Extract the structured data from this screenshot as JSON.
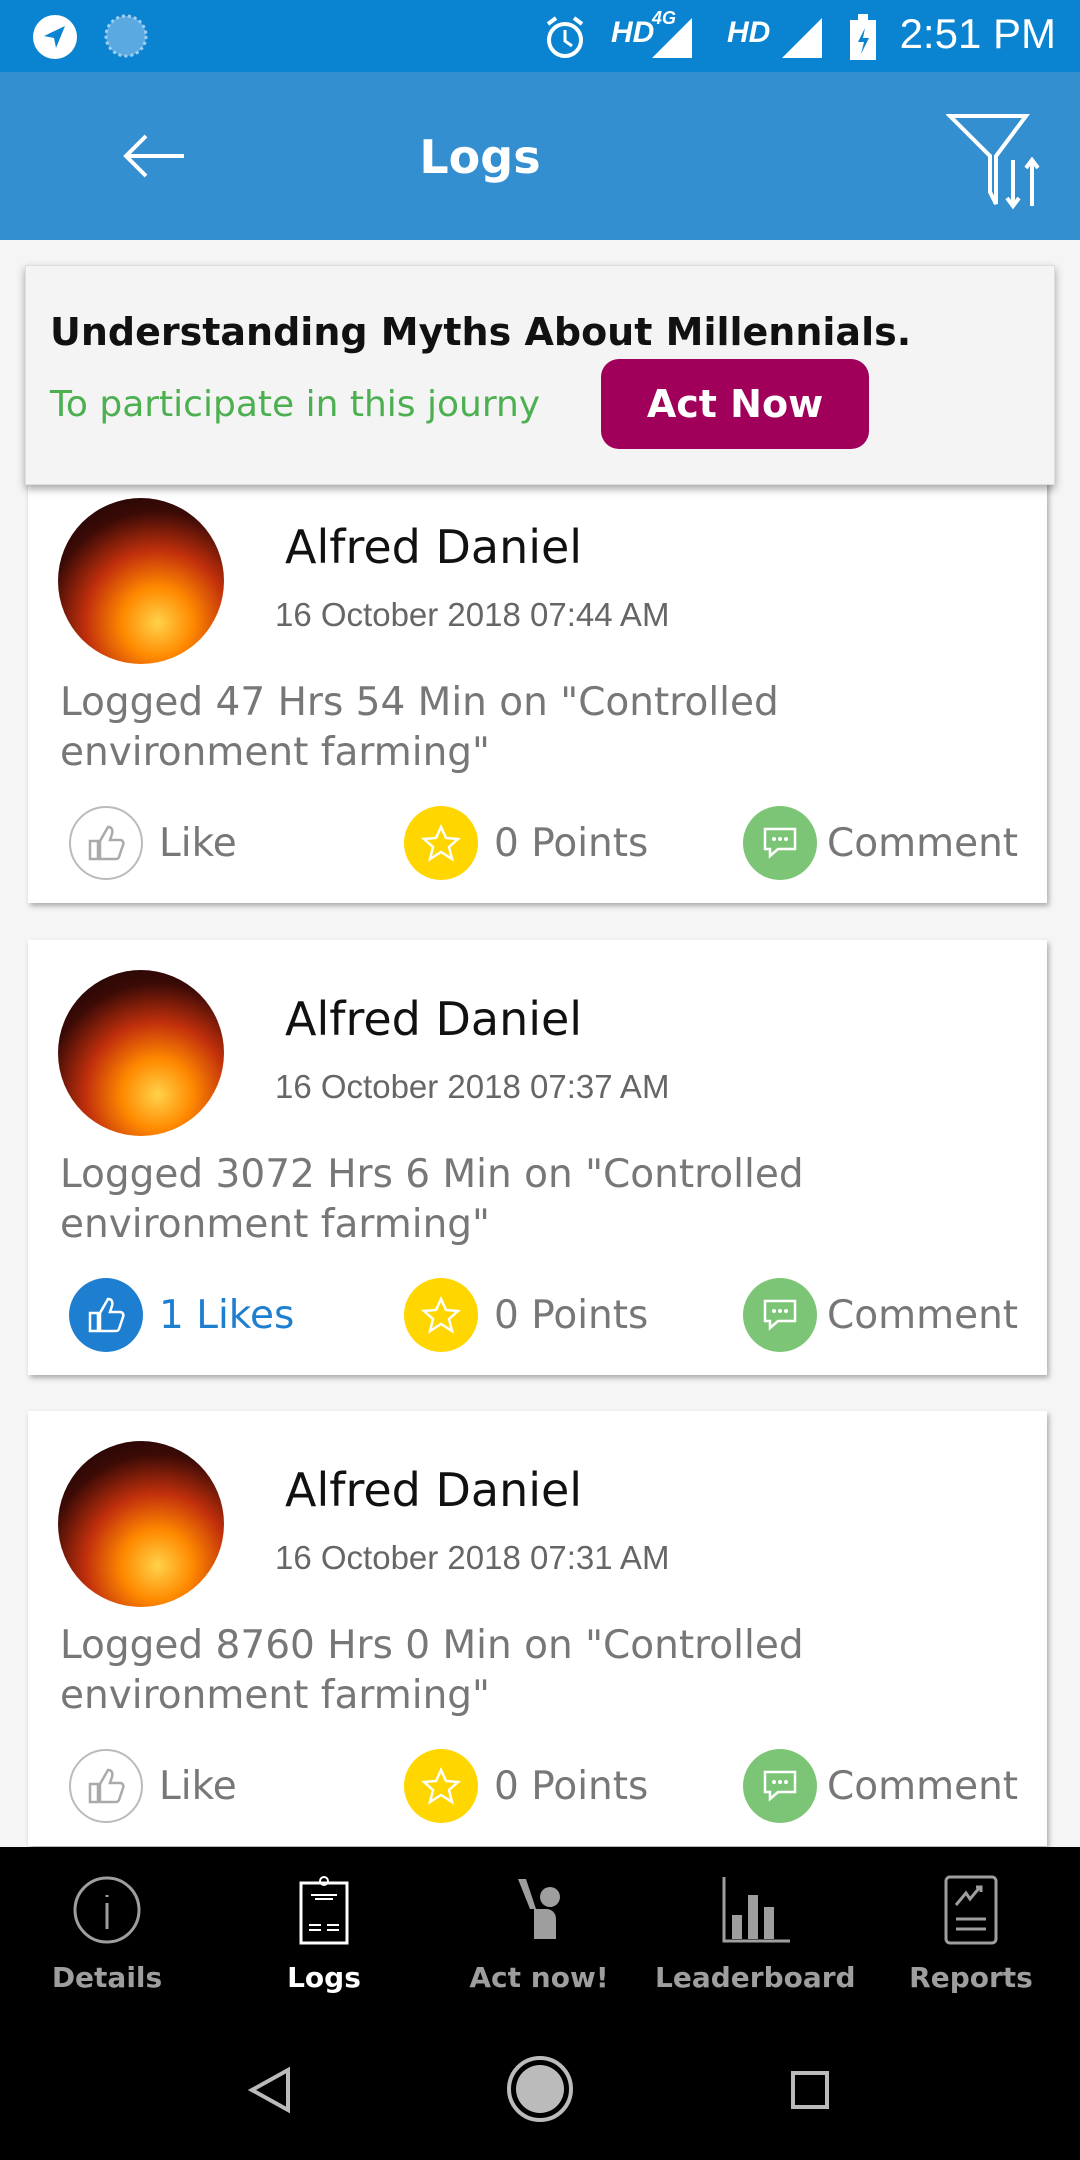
{
  "status_bar": {
    "time": "2:51 PM",
    "network1": "HD",
    "network1_type": "4G",
    "network2": "HD",
    "icons": [
      "telegram-icon",
      "loading-icon",
      "alarm-icon",
      "signal-icon",
      "battery-charging-icon"
    ]
  },
  "app_bar": {
    "title": "Logs",
    "back_icon": "arrow-left-icon",
    "filter_icon": "filter-sort-icon"
  },
  "banner": {
    "title": "Understanding Myths About Millennials.",
    "subtitle": "To participate in this journy",
    "button": "Act Now",
    "button_color": "#a0005a",
    "subtitle_color": "#4caf50"
  },
  "logs": [
    {
      "name": "Alfred Daniel",
      "date": "16 October 2018  07:44 AM",
      "text": "Logged 47 Hrs 54 Min on \"Controlled environment farming\"",
      "like_label": "Like",
      "liked": false,
      "points_label": "0 Points",
      "comment_label": "Comment"
    },
    {
      "name": "Alfred Daniel",
      "date": "16 October 2018  07:37 AM",
      "text": "Logged 3072 Hrs 6 Min on \"Controlled environment farming\"",
      "like_label": "1 Likes",
      "liked": true,
      "points_label": "0 Points",
      "comment_label": "Comment"
    },
    {
      "name": "Alfred Daniel",
      "date": "16 October 2018  07:31 AM",
      "text": "Logged 8760 Hrs 0 Min on \"Controlled environment farming\"",
      "like_label": "Like",
      "liked": false,
      "points_label": "0 Points",
      "comment_label": "Comment"
    }
  ],
  "bottom_nav": [
    {
      "label": "Details",
      "icon": "info-icon"
    },
    {
      "label": "Logs",
      "icon": "clipboard-icon",
      "active": true
    },
    {
      "label": "Act now!",
      "icon": "raised-hand-icon"
    },
    {
      "label": "Leaderboard",
      "icon": "bar-chart-icon"
    },
    {
      "label": "Reports",
      "icon": "report-icon"
    }
  ],
  "colors": {
    "status_bar": "#0a84d0",
    "app_bar": "#348fd0",
    "liked": "#1e7fd0",
    "points": "#ffd600",
    "comment": "#7cc576"
  }
}
